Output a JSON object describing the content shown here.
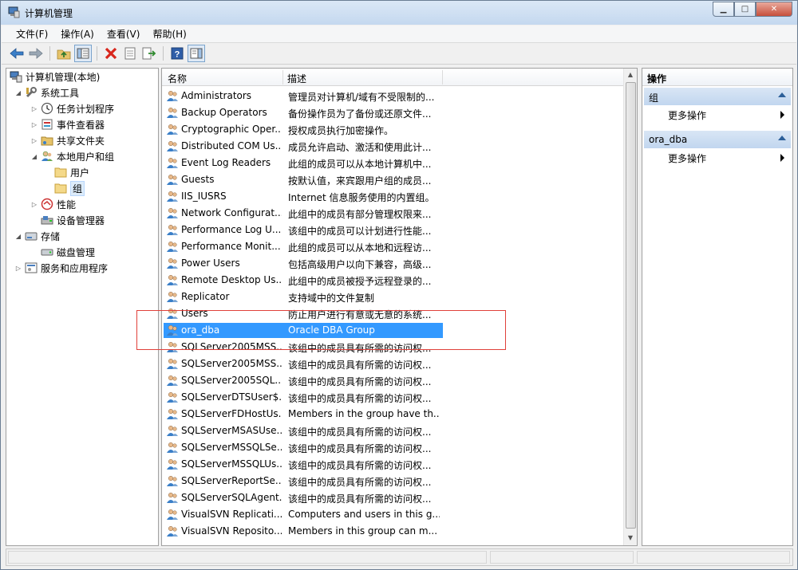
{
  "window": {
    "title": "计算机管理"
  },
  "menu": [
    {
      "label": "文件(F)",
      "name": "menu-file"
    },
    {
      "label": "操作(A)",
      "name": "menu-action"
    },
    {
      "label": "查看(V)",
      "name": "menu-view"
    },
    {
      "label": "帮助(H)",
      "name": "menu-help"
    }
  ],
  "toolbar": {
    "icons": [
      "back-icon",
      "forward-icon",
      "up-folder-icon",
      "show-hide-tree-icon",
      "delete-icon",
      "properties-icon",
      "export-list-icon",
      "help-icon",
      "show-hide-action-pane-icon"
    ]
  },
  "tree": {
    "root": "计算机管理(本地)",
    "system_tools": "系统工具",
    "task_scheduler": "任务计划程序",
    "event_viewer": "事件查看器",
    "shared_folders": "共享文件夹",
    "local_users_groups": "本地用户和组",
    "users": "用户",
    "groups": "组",
    "performance": "性能",
    "device_manager": "设备管理器",
    "storage": "存储",
    "disk_management": "磁盘管理",
    "services_apps": "服务和应用程序"
  },
  "list": {
    "columns": {
      "name": "名称",
      "description": "描述"
    },
    "rows": [
      {
        "name": "Administrators",
        "description": "管理员对计算机/域有不受限制的..."
      },
      {
        "name": "Backup Operators",
        "description": "备份操作员为了备份或还原文件..."
      },
      {
        "name": "Cryptographic Oper...",
        "description": "授权成员执行加密操作。"
      },
      {
        "name": "Distributed COM Us...",
        "description": "成员允许启动、激活和使用此计..."
      },
      {
        "name": "Event Log Readers",
        "description": "此组的成员可以从本地计算机中..."
      },
      {
        "name": "Guests",
        "description": "按默认值，来宾跟用户组的成员..."
      },
      {
        "name": "IIS_IUSRS",
        "description": "Internet 信息服务使用的内置组。"
      },
      {
        "name": "Network Configurat...",
        "description": "此组中的成员有部分管理权限来..."
      },
      {
        "name": "Performance Log U...",
        "description": "该组中的成员可以计划进行性能..."
      },
      {
        "name": "Performance Monit...",
        "description": "此组的成员可以从本地和远程访..."
      },
      {
        "name": "Power Users",
        "description": "包括高级用户以向下兼容，高级..."
      },
      {
        "name": "Remote Desktop Us...",
        "description": "此组中的成员被授予远程登录的..."
      },
      {
        "name": "Replicator",
        "description": "支持域中的文件复制"
      },
      {
        "name": "Users",
        "description": "防止用户进行有意或无意的系统..."
      },
      {
        "name": "ora_dba",
        "description": "Oracle DBA Group"
      },
      {
        "name": "SQLServer2005MSS...",
        "description": "该组中的成员具有所需的访问权..."
      },
      {
        "name": "SQLServer2005MSS...",
        "description": "该组中的成员具有所需的访问权..."
      },
      {
        "name": "SQLServer2005SQL...",
        "description": "该组中的成员具有所需的访问权..."
      },
      {
        "name": "SQLServerDTSUser$...",
        "description": "该组中的成员具有所需的访问权..."
      },
      {
        "name": "SQLServerFDHostUs...",
        "description": "Members in the group have th..."
      },
      {
        "name": "SQLServerMSASUse...",
        "description": "该组中的成员具有所需的访问权..."
      },
      {
        "name": "SQLServerMSSQLSe...",
        "description": "该组中的成员具有所需的访问权..."
      },
      {
        "name": "SQLServerMSSQLUs...",
        "description": "该组中的成员具有所需的访问权..."
      },
      {
        "name": "SQLServerReportSe...",
        "description": "该组中的成员具有所需的访问权..."
      },
      {
        "name": "SQLServerSQLAgent...",
        "description": "该组中的成员具有所需的访问权..."
      },
      {
        "name": "VisualSVN Replicati...",
        "description": "Computers and users in this g..."
      },
      {
        "name": "VisualSVN Reposito...",
        "description": "Members in this group can m..."
      }
    ],
    "selected_index": 14
  },
  "actions": {
    "title": "操作",
    "section1": "组",
    "section1_more": "更多操作",
    "section2": "ora_dba",
    "section2_more": "更多操作"
  },
  "colors": {
    "selection": "#3399ff",
    "highlight_box": "#e0403a"
  }
}
